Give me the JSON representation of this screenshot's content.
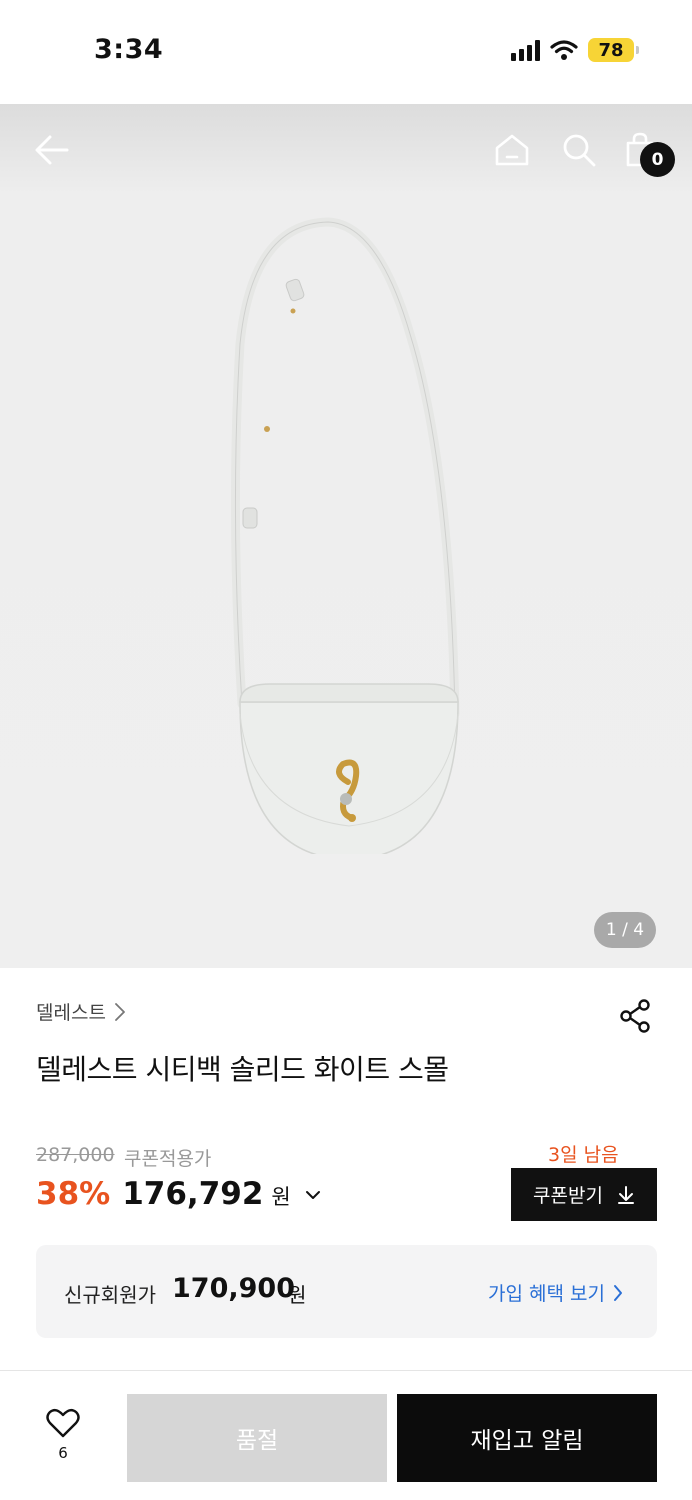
{
  "status_bar": {
    "time": "3:34",
    "battery": "78",
    "signal_icon": "cellular-signal-icon",
    "wifi_icon": "wifi-icon"
  },
  "nav": {
    "back_icon": "arrow-left-icon",
    "home_icon": "home-icon",
    "search_icon": "search-icon",
    "cart_icon": "shopping-bag-icon",
    "cart_count": "0"
  },
  "gallery": {
    "pager": "1 / 4"
  },
  "product": {
    "brand": "델레스트",
    "title": "델레스트 시티백 솔리드 화이트 스몰",
    "original_price": "287,000",
    "coupon_applied_label": "쿠폰적용가",
    "discount": "38%",
    "sale_price": "176,792",
    "currency": "원"
  },
  "coupon": {
    "days_left": "3일 남음",
    "button_label": "쿠폰받기"
  },
  "member": {
    "label": "신규회원가",
    "price": "170,900",
    "currency": "원",
    "benefit_link": "가입 혜택 보기"
  },
  "bottom_bar": {
    "wish_count": "6",
    "soldout_label": "품절",
    "restock_label": "재입고 알림"
  },
  "colors": {
    "accent_orange": "#e8531f",
    "link_blue": "#2a6fd6",
    "battery_yellow": "#f7d436"
  }
}
